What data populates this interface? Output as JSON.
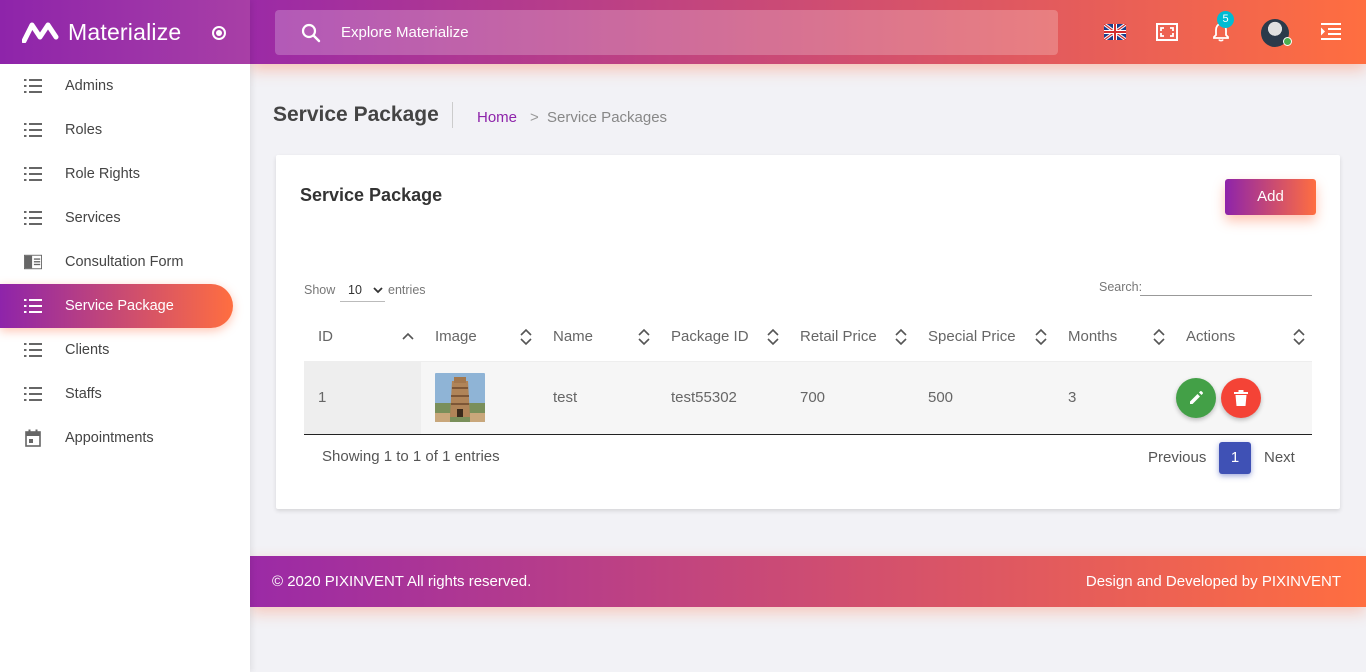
{
  "brand": {
    "name": "Materialize"
  },
  "search": {
    "placeholder": "Explore Materialize"
  },
  "header": {
    "notification_count": "5"
  },
  "sidebar": {
    "items": [
      {
        "label": "Admins",
        "icon": "list-icon"
      },
      {
        "label": "Roles",
        "icon": "list-icon"
      },
      {
        "label": "Role Rights",
        "icon": "list-icon"
      },
      {
        "label": "Services",
        "icon": "list-icon"
      },
      {
        "label": "Consultation Form",
        "icon": "chrome-reader-icon"
      },
      {
        "label": "Service Package",
        "icon": "list-icon",
        "active": true
      },
      {
        "label": "Clients",
        "icon": "list-icon"
      },
      {
        "label": "Staffs",
        "icon": "list-icon"
      },
      {
        "label": "Appointments",
        "icon": "calendar-icon"
      }
    ]
  },
  "page": {
    "title": "Service Package",
    "breadcrumb": {
      "home": "Home",
      "separator": ">",
      "current": "Service Packages"
    }
  },
  "card": {
    "title": "Service Package",
    "add_label": "Add",
    "length": {
      "show": "Show",
      "value": "10",
      "entries": "entries"
    },
    "search_label": "Search:",
    "columns": [
      "ID",
      "Image",
      "Name",
      "Package ID",
      "Retail Price",
      "Special Price",
      "Months",
      "Actions"
    ],
    "rows": [
      {
        "id": "1",
        "name": "test",
        "package_id": "test55302",
        "retail_price": "700",
        "special_price": "500",
        "months": "3"
      }
    ],
    "info": "Showing 1 to 1 of 1 entries",
    "pagination": {
      "previous": "Previous",
      "current": "1",
      "next": "Next"
    }
  },
  "footer": {
    "left_prefix": "© 2020 ",
    "left_brand": "PIXINVENT",
    "left_suffix": " All rights reserved.",
    "right_prefix": "Design and Developed by ",
    "right_brand": "PIXINVENT"
  },
  "colors": {
    "primary": "#8e24aa",
    "accent": "#ff6e40",
    "pagination": "#3f51b5",
    "edit": "#43a047",
    "delete": "#f44336"
  }
}
